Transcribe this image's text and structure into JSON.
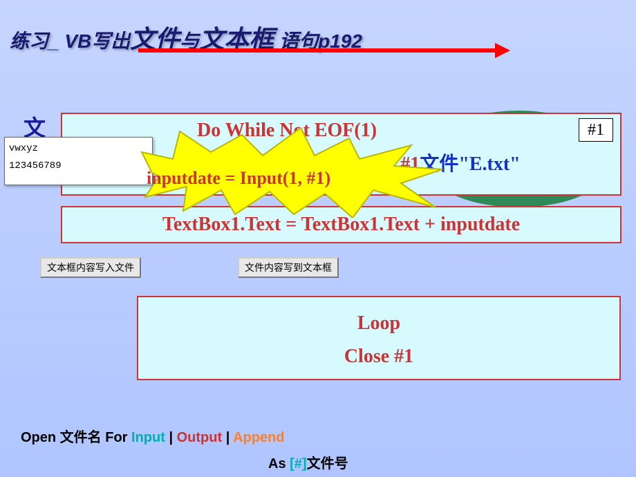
{
  "title_parts": {
    "p1": "练习_  VB写出",
    "p2": "文件",
    "p3": "与",
    "p4": "文本框",
    "p5": "  语句p192"
  },
  "side_label": "文",
  "textbox": {
    "line1": "vwxyz",
    "line2": "123456789"
  },
  "hash": "#1",
  "code": {
    "do_while": "Do While Not EOF(1)",
    "open_left": "Open \"E.txt\" For Input As #1",
    "open_right": "文件\"E.txt\"",
    "input": "inputdate = Input(1, #1)",
    "assign": "TextBox1.Text = TextBox1.Text + inputdate",
    "loop": "Loop",
    "close": "Close #1"
  },
  "buttons": {
    "b1": "文本框内容写入文件",
    "b2": "文件内容写到文本框"
  },
  "syntax": {
    "open": "Open  ",
    "filename": "文件名",
    "for": "   For  ",
    "input": "Input ",
    "pipe1": "| ",
    "output": "Output ",
    "pipe2": "| ",
    "append": "Append",
    "as": "As  ",
    "hash": "[#]",
    "fileno": "文件号"
  }
}
